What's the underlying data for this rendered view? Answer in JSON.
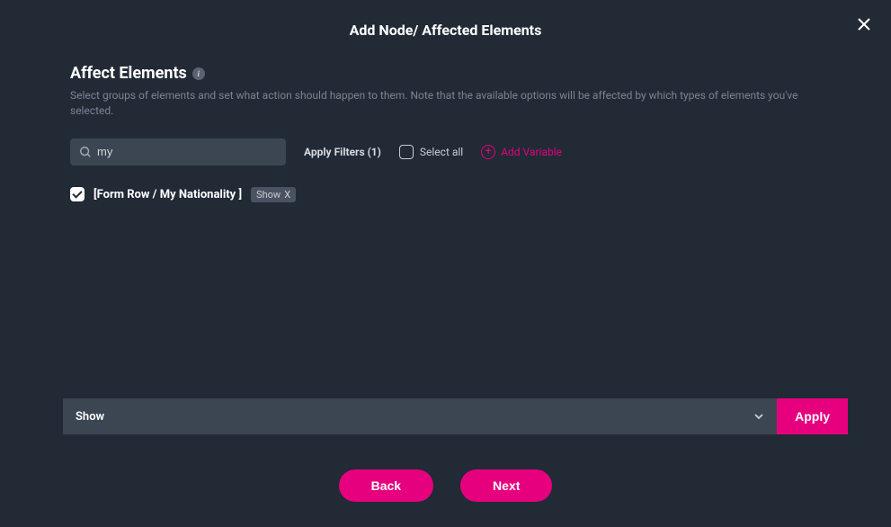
{
  "modal": {
    "title": "Add Node/ Affected Elements"
  },
  "section": {
    "title": "Affect Elements",
    "description": "Select groups of elements and set what action should happen to them. Note that the available options will be affected by which types of elements you've selected."
  },
  "controls": {
    "search_value": "my",
    "apply_filters_label": "Apply Filters (1)",
    "select_all_label": "Select all",
    "add_variable_label": "Add Variable"
  },
  "items": [
    {
      "label": "[Form Row / My Nationality ]",
      "tag": "Show",
      "tag_close": "X"
    }
  ],
  "action": {
    "select_value": "Show",
    "apply_label": "Apply"
  },
  "footer": {
    "back_label": "Back",
    "next_label": "Next"
  }
}
